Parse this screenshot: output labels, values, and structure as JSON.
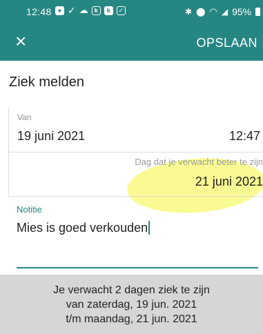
{
  "statusbar": {
    "time": "12:48",
    "left_icons": [
      "shield-icon",
      "check-icon",
      "cloud-icon",
      "app-icon",
      "app-icon-2",
      "checkbox-icon"
    ],
    "right_icons": [
      "bluetooth-icon",
      "location-icon",
      "wifi-icon",
      "signal-icon"
    ],
    "battery": "95%"
  },
  "appbar": {
    "close_symbol": "×",
    "save_label": "OPSLAAN"
  },
  "page_title": "Ziek melden",
  "van": {
    "label": "Van",
    "date": "19 juni 2021",
    "time": "12:47"
  },
  "tot": {
    "hint": "Dag dat je verwacht beter te zijn",
    "date": "21 juni 2021"
  },
  "notitie": {
    "label": "Notitie",
    "value": "Mies is goed verkouden"
  },
  "summary": {
    "line1": "Je verwacht 2 dagen ziek te zijn",
    "line2": "van zaterdag, 19 jun. 2021",
    "line3": "t/m maandag, 21 jun. 2021"
  },
  "colors": {
    "primary": "#268682",
    "highlight": "#f6f63c",
    "summary_bg": "#d6d6d6"
  }
}
